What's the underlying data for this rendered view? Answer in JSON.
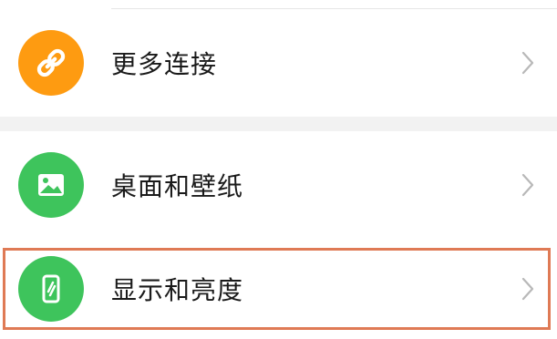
{
  "settings": {
    "items": [
      {
        "label": "更多连接",
        "icon": "link-icon",
        "icon_color": "#fe9b11"
      },
      {
        "label": "桌面和壁纸",
        "icon": "image-icon",
        "icon_color": "#3ec45c"
      },
      {
        "label": "显示和亮度",
        "icon": "phone-brightness-icon",
        "icon_color": "#3ec45c",
        "highlighted": true
      }
    ]
  },
  "colors": {
    "highlight_border": "#df7a55",
    "section_gap": "#f2f2f2",
    "chevron": "#b8b8b8"
  }
}
